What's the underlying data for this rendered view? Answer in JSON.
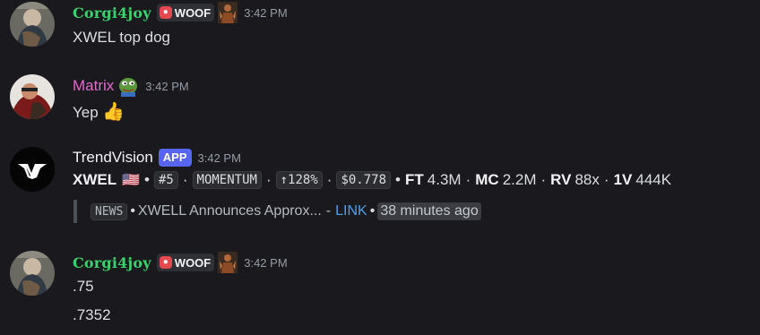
{
  "messages": [
    {
      "username": "Corgi4joy",
      "role_tag": "WOOF",
      "time": "3:42 PM",
      "lines": [
        "XWEL top dog"
      ]
    },
    {
      "username": "Matrix",
      "time": "3:42 PM",
      "lines": [
        "Yep"
      ],
      "emoji": "👍"
    },
    {
      "username": "TrendVision",
      "badge": "APP",
      "time": "3:42 PM",
      "ticker": {
        "symbol": "XWEL",
        "flag": "🇺🇸",
        "rank": "#5",
        "signal": "MOMENTUM",
        "change": "↑128%",
        "price": "$0.778",
        "ft_label": "FT",
        "ft_value": "4.3M",
        "mc_label": "MC",
        "mc_value": "2.2M",
        "rv_label": "RV",
        "rv_value": "88x",
        "v1_label": "1V",
        "v1_value": "444K"
      },
      "news": {
        "tag": "NEWS",
        "headline": "XWELL Announces Approx...",
        "link_label": "LINK",
        "age": "38 minutes ago"
      }
    },
    {
      "username": "Corgi4joy",
      "role_tag": "WOOF",
      "time": "3:42 PM",
      "lines": [
        ".75",
        ".7352"
      ]
    }
  ],
  "colors": {
    "background": "#1a1a1e",
    "corgi_name": "#3ccf6e",
    "matrix_name": "#e468cf",
    "app_badge": "#5865f2",
    "link": "#4f9de8"
  }
}
